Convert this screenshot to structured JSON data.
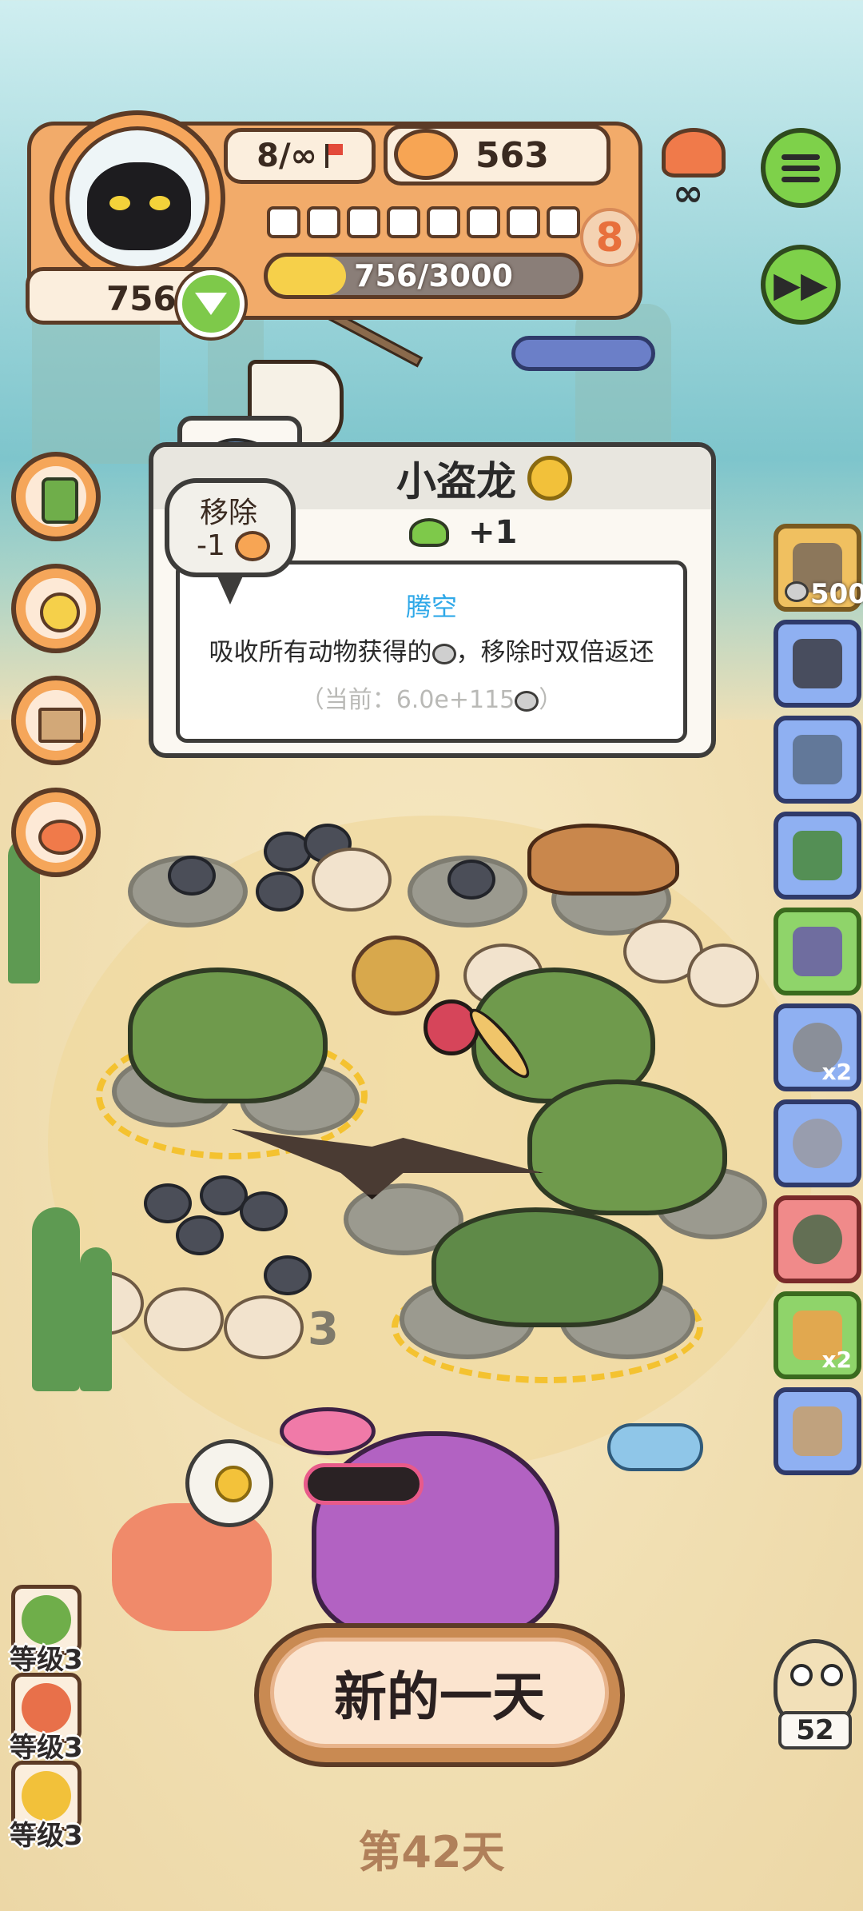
{
  "hud": {
    "capacity": "8/∞",
    "coins": "563",
    "hearts": "756",
    "level": "8",
    "exp": "756/3000",
    "exp_fraction": 0.252,
    "slots_count": 8
  },
  "tooltip": {
    "title": "小盗龙",
    "bonus": "+1",
    "skill_name": "腾空",
    "skill_desc_a": "吸收所有动物获得的",
    "skill_desc_b": "，移除时双倍返还",
    "current_a": "（当前：6.0e+115",
    "current_b": "）"
  },
  "remove_bubble": {
    "label": "移除",
    "cost": "-1"
  },
  "shop": {
    "first_price": "500",
    "x2_a": "x2",
    "x2_b": "x2"
  },
  "pad_number": "3",
  "levels": [
    {
      "label": "等级3"
    },
    {
      "label": "等级3"
    },
    {
      "label": "等级3"
    }
  ],
  "new_day_label": "新的一天",
  "day_label": "第42天",
  "owl_count": "52",
  "colors": {
    "accent_orange": "#f2ab6a",
    "skill_blue": "#2fa8e8",
    "button_green": "#7ed14a"
  }
}
